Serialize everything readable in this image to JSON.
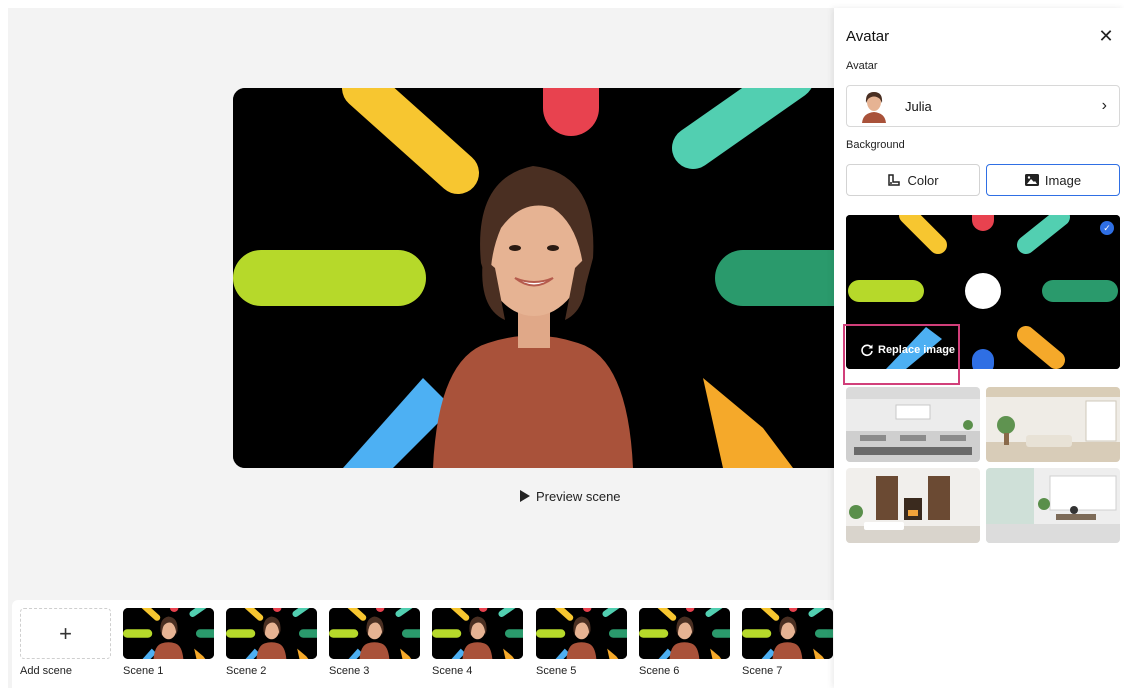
{
  "preview": {
    "label": "Preview scene"
  },
  "timeline": {
    "add_scene_label": "Add scene",
    "scenes": [
      "Scene 1",
      "Scene 2",
      "Scene 3",
      "Scene 4",
      "Scene 5",
      "Scene 6",
      "Scene 7"
    ]
  },
  "panel": {
    "title": "Avatar",
    "avatar_section": "Avatar",
    "avatar_name": "Julia",
    "background_section": "Background",
    "color_label": "Color",
    "image_label": "Image",
    "replace_label": "Replace image"
  },
  "colors": {
    "accent": "#2f6fe4",
    "highlight": "#d13f7a",
    "yellow": "#f7c630",
    "red": "#e8424f",
    "teal": "#52cfb1",
    "lime": "#b6d92a",
    "green": "#2a9a6c",
    "blue": "#4db0f3",
    "orange": "#f5a92a",
    "shirt": "#a9523a",
    "hair": "#4a2f22",
    "skin": "#e6b393"
  }
}
